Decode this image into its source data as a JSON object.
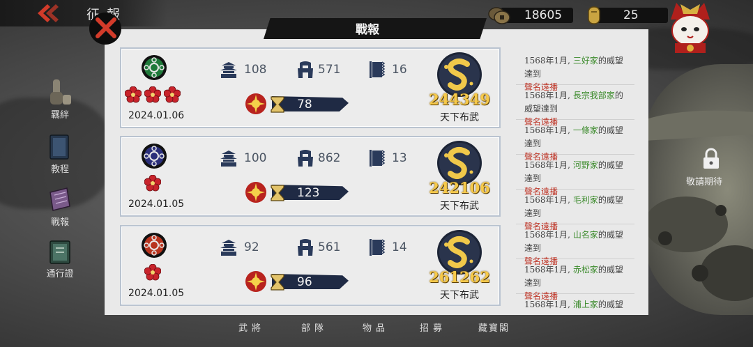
{
  "top": {
    "page_title": "征報",
    "currency": [
      {
        "name": "copper-coin",
        "value": "18605"
      },
      {
        "name": "gold-ingot",
        "value": "25"
      }
    ]
  },
  "side_menu": [
    {
      "label": "羈絆",
      "icon": "sake-icon"
    },
    {
      "label": "教程",
      "icon": "book-icon"
    },
    {
      "label": "戰報",
      "icon": "scroll-icon"
    },
    {
      "label": "通行證",
      "icon": "pass-icon"
    }
  ],
  "dialog": {
    "title": "戰報",
    "reports": [
      {
        "date": "2024.01.06",
        "castle": "108",
        "helmet": "571",
        "banner": "16",
        "rank": "78",
        "score": "244349",
        "result": "天下布武",
        "flowers": 3,
        "crest_color": "#1f7a3a"
      },
      {
        "date": "2024.01.05",
        "castle": "100",
        "helmet": "862",
        "banner": "13",
        "rank": "123",
        "score": "242106",
        "result": "天下布武",
        "flowers": 1,
        "crest_color": "#2b2f7a"
      },
      {
        "date": "2024.01.05",
        "castle": "92",
        "helmet": "561",
        "banner": "14",
        "rank": "96",
        "score": "261262",
        "result": "天下布武",
        "flowers": 1,
        "crest_color": "#b8341e"
      }
    ],
    "log": [
      {
        "prefix": "1568年1月, ",
        "clan": "三好家",
        "suffix": "的威望達到",
        "title": "聲名遠播"
      },
      {
        "prefix": "1568年1月, ",
        "clan": "長宗我部家",
        "suffix": "的威望達到",
        "title": "聲名遠播"
      },
      {
        "prefix": "1568年1月, ",
        "clan": "一條家",
        "suffix": "的威望達到",
        "title": "聲名遠播"
      },
      {
        "prefix": "1568年1月, ",
        "clan": "河野家",
        "suffix": "的威望達到",
        "title": "聲名遠播"
      },
      {
        "prefix": "1568年1月, ",
        "clan": "毛利家",
        "suffix": "的威望達到",
        "title": "聲名遠播"
      },
      {
        "prefix": "1568年1月, ",
        "clan": "山名家",
        "suffix": "的威望達到",
        "title": "聲名遠播"
      },
      {
        "prefix": "1568年1月, ",
        "clan": "赤松家",
        "suffix": "的威望達到",
        "title": "聲名遠播"
      },
      {
        "prefix": "1568年1月, ",
        "clan": "浦上家",
        "suffix": "的威望達到",
        "title": ""
      }
    ]
  },
  "locked": {
    "label": "敬請期待"
  },
  "bottom_nav": [
    "武將",
    "部隊",
    "物品",
    "招募",
    "藏寶閣"
  ],
  "colors": {
    "accent_red": "#c0392b",
    "clan_green": "#3a8a2a",
    "score_gold": "#f6c94a",
    "navy": "#1f2a44"
  }
}
